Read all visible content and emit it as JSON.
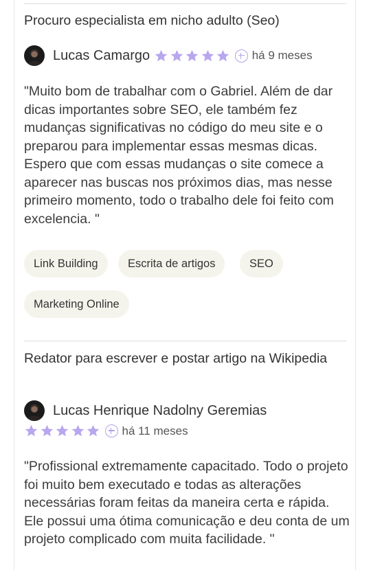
{
  "reviews": [
    {
      "title": "Procuro especialista em nicho adulto (Seo)",
      "reviewer": "Lucas Camargo",
      "rating": 5,
      "time": "há 9 meses",
      "text": "\"Muito bom de trabalhar com o Gabriel. Além de dar dicas importantes sobre SEO, ele também fez mudanças significativas no código do meu site e o preparou para implementar essas mesmas dicas. Espero que com essas mudanças o site comece a aparecer nas buscas nos próximos dias, mas nesse primeiro momento, todo o trabalho dele foi feito com excelencia. \"",
      "tags": [
        "Link Building",
        "Escrita de artigos",
        "SEO",
        "Marketing Online"
      ]
    },
    {
      "title": "Redator para escrever e postar artigo na Wikipedia",
      "reviewer": "Lucas Henrique Nadolny Geremias",
      "rating": 5,
      "time": "há 11 meses",
      "text": "\"Profissional extremamente capacitado. Todo o projeto foi muito bem executado e todas as alterações necessárias foram feitas da maneira certa e rápida. Ele possui uma ótima comunicação e deu conta de um projeto complicado com muita facilidade. \""
    }
  ],
  "icons": {
    "avatar": "avatar-photo",
    "star": "star-icon",
    "add": "plus-circle-icon"
  },
  "colors": {
    "star": "#b8a6ee",
    "tag_bg": "#f5f4ec",
    "divider": "#dcdcdc"
  }
}
